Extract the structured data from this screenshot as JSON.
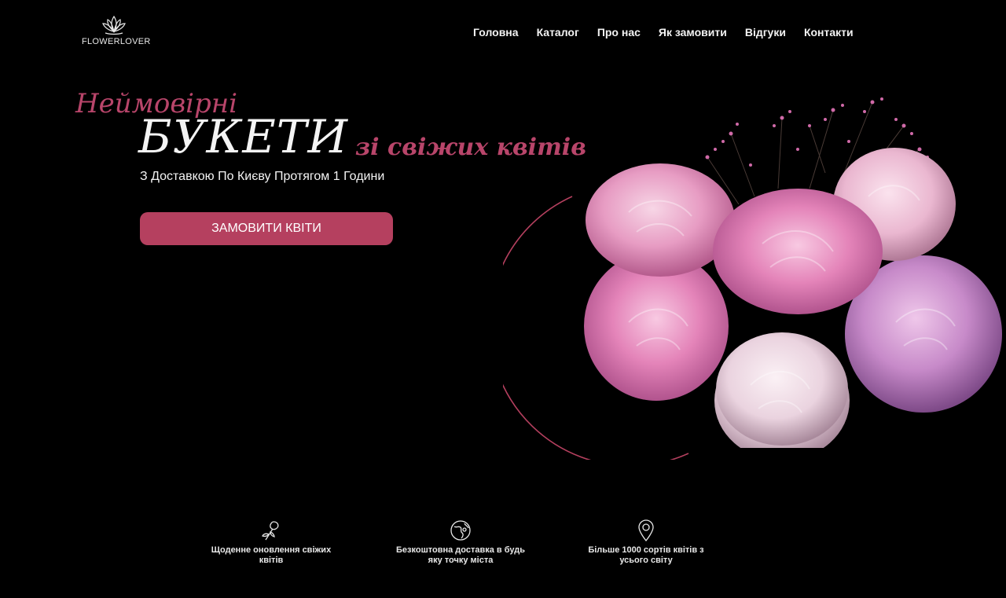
{
  "brand": {
    "name": "FLOWERLOVER",
    "logo_icon": "lotus-icon"
  },
  "nav": {
    "items": [
      {
        "label": "Головна"
      },
      {
        "label": "Каталог"
      },
      {
        "label": "Про нас"
      },
      {
        "label": "Як замовити"
      },
      {
        "label": "Відгуки"
      },
      {
        "label": "Контакти"
      }
    ]
  },
  "hero": {
    "line1": "Неймовірні",
    "line2": "БУКЕТИ",
    "line3": "зі свіжих квітів",
    "subtitle": "З Доставкою По Києву Протягом 1 Години",
    "cta_label": "Замовити квіти",
    "image": "peony-bouquet"
  },
  "features": [
    {
      "icon": "rose-icon",
      "text_line1": "Щоденне оновлення свіжих",
      "text_line2": "квітів"
    },
    {
      "icon": "globe-delivery-icon",
      "text_line1": "Безкоштовна доставка в будь",
      "text_line2": "яку точку міста"
    },
    {
      "icon": "location-pin-icon",
      "text_line1": "Більше 1000 сортів квітів з",
      "text_line2": "усього світу"
    }
  ],
  "colors": {
    "background": "#000000",
    "accent": "#b5405f",
    "text": "#f4f4f4"
  }
}
